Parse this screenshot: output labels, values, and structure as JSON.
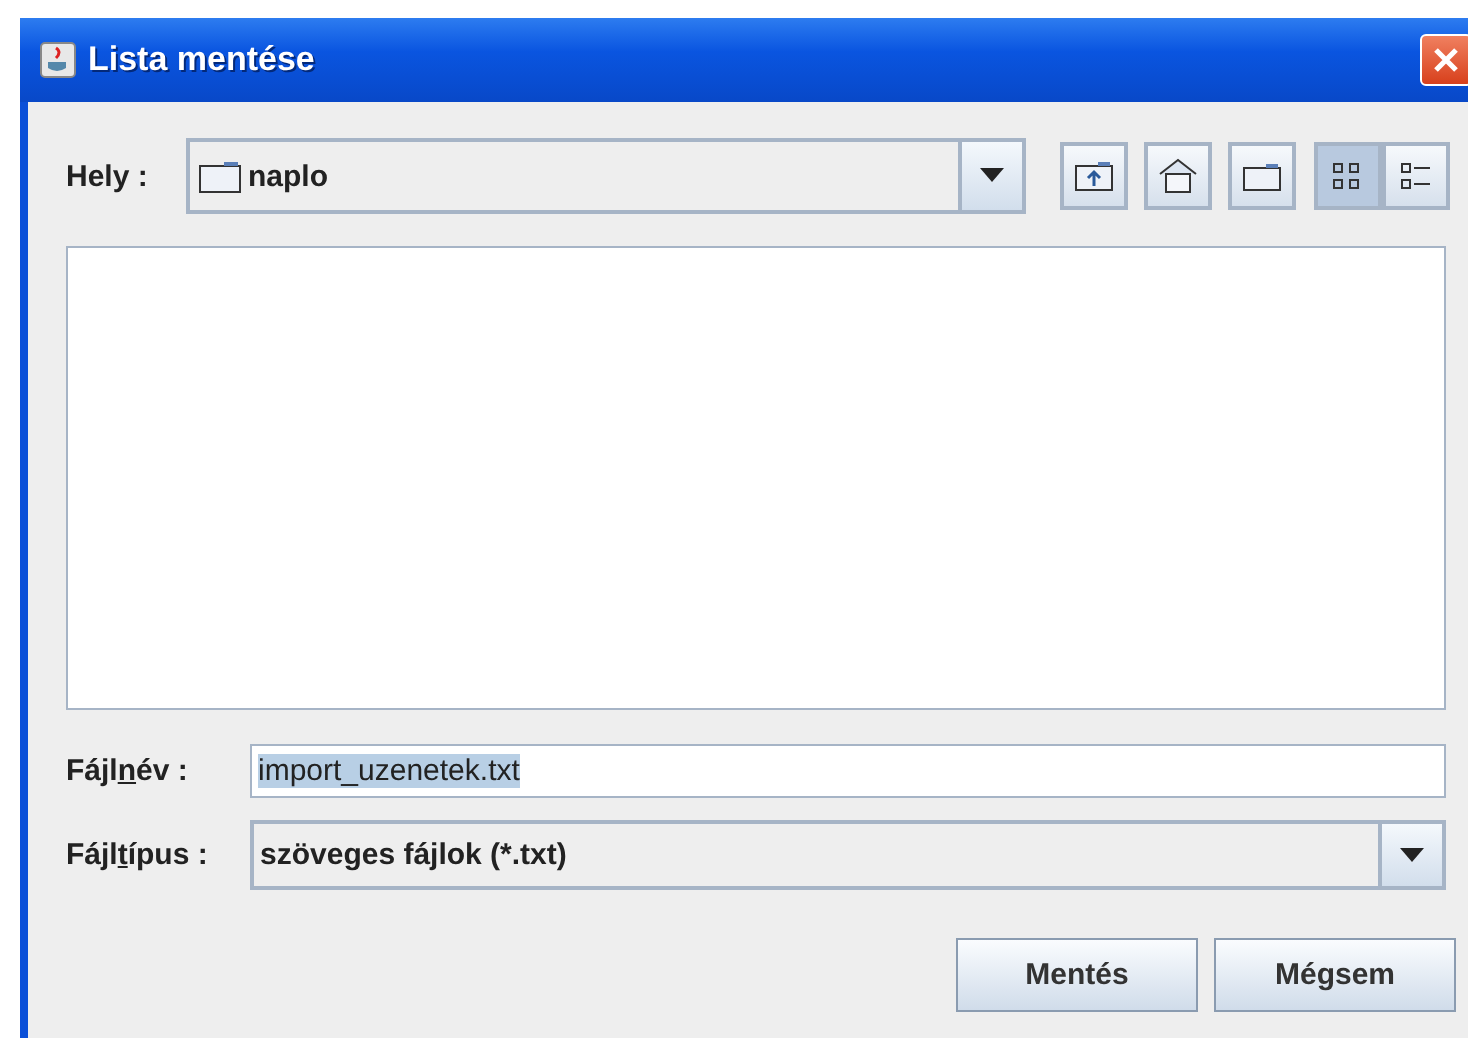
{
  "window": {
    "title": "Lista mentése"
  },
  "location": {
    "label": "Hely :",
    "value": "naplo"
  },
  "toolbar": [
    {
      "kind": "up",
      "selected": false
    },
    {
      "kind": "home",
      "selected": false
    },
    {
      "kind": "newfolder",
      "selected": false
    },
    {
      "kind": "list",
      "selected": true
    },
    {
      "kind": "details",
      "selected": false
    }
  ],
  "filename": {
    "label_parts": [
      "Fájl",
      "n",
      "év :"
    ],
    "value": "import_uzenetek.txt"
  },
  "filetype": {
    "label_parts": [
      "Fájl",
      "t",
      "ípus :"
    ],
    "value": "szöveges fájlok (*.txt)"
  },
  "buttons": [
    "Mentés",
    "Mégsem"
  ]
}
